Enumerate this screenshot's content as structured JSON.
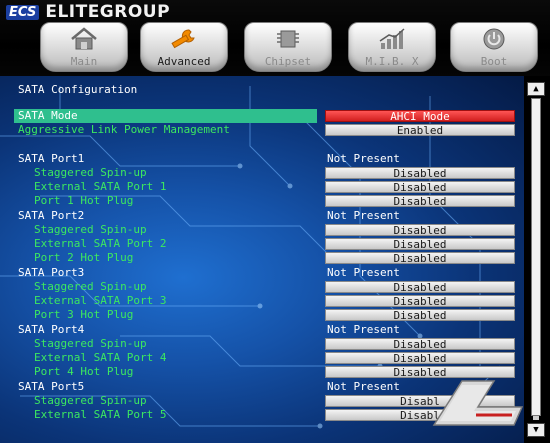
{
  "brand": {
    "logo": "ECS",
    "name": "ELITEGROUP"
  },
  "tabs": [
    {
      "label": "Main",
      "icon": "house-icon"
    },
    {
      "label": "Advanced",
      "icon": "wrench-icon",
      "active": true
    },
    {
      "label": "Chipset",
      "icon": "chip-icon"
    },
    {
      "label": "M.I.B. X",
      "icon": "chart-icon"
    },
    {
      "label": "Boot",
      "icon": "power-icon"
    }
  ],
  "section_title": "SATA Configuration",
  "settings": {
    "sata_mode": {
      "label": "SATA Mode",
      "value": "AHCI Mode"
    },
    "alpm": {
      "label": "Aggressive Link Power Management",
      "value": "Enabled"
    }
  },
  "ports": [
    {
      "title": "SATA Port1",
      "status": "Not Present",
      "staggered": "Staggered Spin-up",
      "staggered_value": "Disabled",
      "external": "External SATA Port 1",
      "external_value": "Disabled",
      "hotplug": "Port 1 Hot Plug",
      "hotplug_value": "Disabled"
    },
    {
      "title": "SATA Port2",
      "status": "Not Present",
      "staggered": "Staggered Spin-up",
      "staggered_value": "Disabled",
      "external": "External SATA Port 2",
      "external_value": "Disabled",
      "hotplug": "Port 2 Hot Plug",
      "hotplug_value": "Disabled"
    },
    {
      "title": "SATA Port3",
      "status": "Not Present",
      "staggered": "Staggered Spin-up",
      "staggered_value": "Disabled",
      "external": "External SATA Port 3",
      "external_value": "Disabled",
      "hotplug": "Port 3 Hot Plug",
      "hotplug_value": "Disabled"
    },
    {
      "title": "SATA Port4",
      "status": "Not Present",
      "staggered": "Staggered Spin-up",
      "staggered_value": "Disabled",
      "external": "External SATA Port 4",
      "external_value": "Disabled",
      "hotplug": "Port 4 Hot Plug",
      "hotplug_value": "Disabled"
    },
    {
      "title": "SATA Port5",
      "status": "Not Present",
      "staggered": "Staggered Spin-up",
      "staggered_value": "Disabl",
      "external": "External SATA Port 5",
      "external_value": "Disabl"
    }
  ],
  "watermark": {
    "text": "Legit Reviews"
  },
  "colors": {
    "highlight": "#2fbf8e",
    "selected_value": "#e02a2a",
    "label_green": "#3ce860",
    "background_blue": "#1552a8"
  }
}
